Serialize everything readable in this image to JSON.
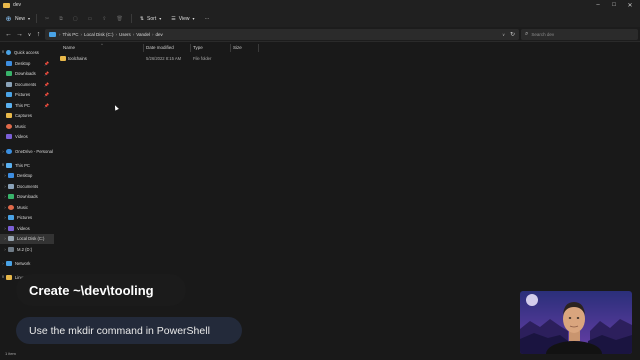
{
  "window": {
    "title": "dev"
  },
  "toolbar": {
    "new_label": "New",
    "sort_label": "Sort",
    "view_label": "View",
    "more_label": "···"
  },
  "address": {
    "crumbs": [
      "This PC",
      "Local Disk (C:)",
      "Users",
      "Vandel",
      "dev"
    ],
    "search_placeholder": "Search dev"
  },
  "columns": [
    "Name",
    "Date modified",
    "Type",
    "Size"
  ],
  "files": [
    {
      "name": "toolchains",
      "date": "5/26/2022 8:15 AM",
      "type": "File folder",
      "size": ""
    }
  ],
  "sidebar": {
    "quick_access": {
      "label": "Quick access",
      "items": [
        {
          "label": "Desktop",
          "icon": "desktop-icon",
          "pinned": true
        },
        {
          "label": "Downloads",
          "icon": "downloads-icon",
          "pinned": true
        },
        {
          "label": "Documents",
          "icon": "documents-icon",
          "pinned": true
        },
        {
          "label": "Pictures",
          "icon": "pictures-icon",
          "pinned": true
        },
        {
          "label": "This PC",
          "icon": "pc-icon",
          "pinned": true
        },
        {
          "label": "Captures",
          "icon": "folder-icon",
          "pinned": false
        },
        {
          "label": "Music",
          "icon": "music-icon",
          "pinned": false
        },
        {
          "label": "Videos",
          "icon": "videos-icon",
          "pinned": false
        }
      ]
    },
    "onedrive": {
      "label": "OneDrive - Personal"
    },
    "this_pc": {
      "label": "This PC",
      "items": [
        {
          "label": "Desktop",
          "icon": "desktop-icon"
        },
        {
          "label": "Documents",
          "icon": "documents-icon"
        },
        {
          "label": "Downloads",
          "icon": "downloads-icon"
        },
        {
          "label": "Music",
          "icon": "music-icon"
        },
        {
          "label": "Pictures",
          "icon": "pictures-icon"
        },
        {
          "label": "Videos",
          "icon": "videos-icon"
        },
        {
          "label": "Local Disk (C:)",
          "icon": "drive-icon",
          "selected": true
        },
        {
          "label": "M.2 (D:)",
          "icon": "drive-icon"
        }
      ]
    },
    "network": {
      "label": "Network"
    },
    "linux": {
      "label": "Linux"
    }
  },
  "status": {
    "items": "1 item"
  },
  "overlay": {
    "headline": "Create ~\\dev\\tooling",
    "subtitle": "Use the mkdir command in PowerShell"
  },
  "colors": {
    "background": "#191919",
    "folder": "#e8b84a",
    "accent": "#4aa3e6",
    "caption_bg": "#232a3a"
  }
}
